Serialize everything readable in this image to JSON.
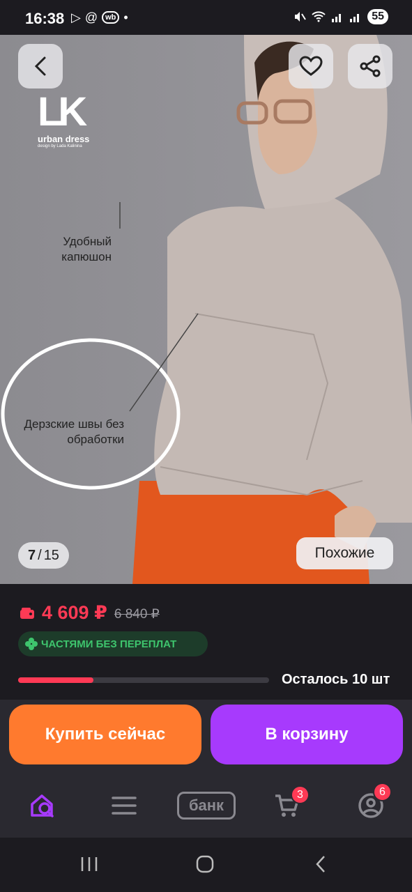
{
  "status_bar": {
    "time": "16:38",
    "left_icons": [
      "play-icon",
      "at-icon",
      "wb-icon",
      "dot-icon"
    ],
    "wb_label": "wb",
    "battery": "55"
  },
  "product_image": {
    "brand_mark": "LK",
    "brand_name": "urban dress",
    "brand_tagline": "design by Lada Kalinina",
    "callout_hood": "Удобный капюшон",
    "callout_seams": "Дерзские швы без обработки",
    "counter_current": "7",
    "counter_separator": "/",
    "counter_total": "15",
    "similar_label": "Похожие"
  },
  "pricing": {
    "current_price": "4 609 ₽",
    "old_price": "6 840 ₽",
    "installment_label": "ЧАСТЯМИ БЕЗ ПЕРЕПЛАТ",
    "stock_label": "Осталось 10 шт",
    "stock_level_fraction": 0.3
  },
  "actions": {
    "buy_now": "Купить сейчас",
    "add_to_cart": "В корзину"
  },
  "bottom_nav": {
    "items": [
      "search-home-icon",
      "catalog-icon",
      "bank",
      "cart-icon",
      "profile-icon"
    ],
    "bank_label": "банк",
    "cart_badge": "3",
    "profile_badge": "6"
  },
  "colors": {
    "accent_purple": "#a73afd",
    "buy_orange": "#ff7a2e",
    "price_red": "#ff3a55",
    "installment_green": "#3ec46d"
  }
}
